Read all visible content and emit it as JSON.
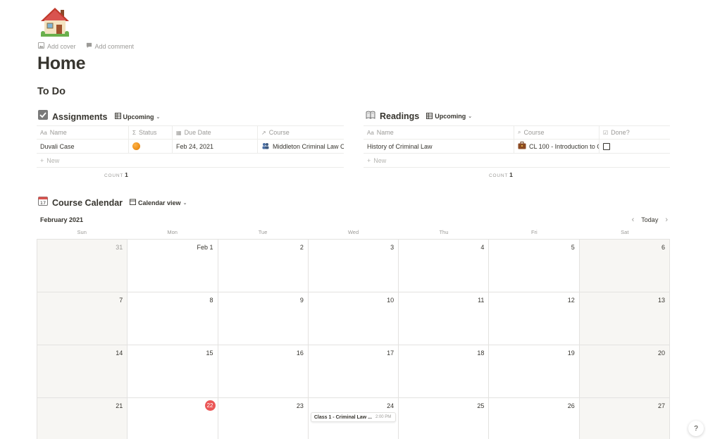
{
  "page": {
    "icon": "house-emoji",
    "add_cover": "Add cover",
    "add_comment": "Add comment",
    "title": "Home",
    "todo_heading": "To Do"
  },
  "assignments": {
    "icon": "check-box-emoji",
    "title": "Assignments",
    "view": "Upcoming",
    "columns": [
      "Name",
      "Status",
      "Due Date",
      "Course"
    ],
    "rows": [
      {
        "name": "Duvali Case",
        "status": "orange-circle",
        "due_date": "Feb 24, 2021",
        "course": "Middleton Criminal Law C"
      }
    ],
    "new_label": "New",
    "count_label": "COUNT",
    "count_value": "1"
  },
  "readings": {
    "icon": "open-book-emoji",
    "title": "Readings",
    "view": "Upcoming",
    "columns": [
      "Name",
      "Course",
      "Done?"
    ],
    "rows": [
      {
        "name": "History of Criminal Law",
        "course": "CL 100 - Introduction to C",
        "done": false
      }
    ],
    "new_label": "New",
    "count_label": "COUNT",
    "count_value": "1"
  },
  "calendar": {
    "icon": "calendar-emoji",
    "title": "Course Calendar",
    "view": "Calendar view",
    "month": "February 2021",
    "today_label": "Today",
    "weekdays": [
      "Sun",
      "Mon",
      "Tue",
      "Wed",
      "Thu",
      "Fri",
      "Sat"
    ],
    "weeks": [
      [
        "31",
        "Feb 1",
        "2",
        "3",
        "4",
        "5",
        "6"
      ],
      [
        "7",
        "8",
        "9",
        "10",
        "11",
        "12",
        "13"
      ],
      [
        "14",
        "15",
        "16",
        "17",
        "18",
        "19",
        "20"
      ],
      [
        "21",
        "22",
        "23",
        "24",
        "25",
        "26",
        "27"
      ]
    ],
    "today": "22",
    "event": {
      "title": "Class 1 - Criminal Law ...",
      "time": "2:00 PM",
      "day": "24"
    }
  },
  "help": {
    "label": "?"
  }
}
